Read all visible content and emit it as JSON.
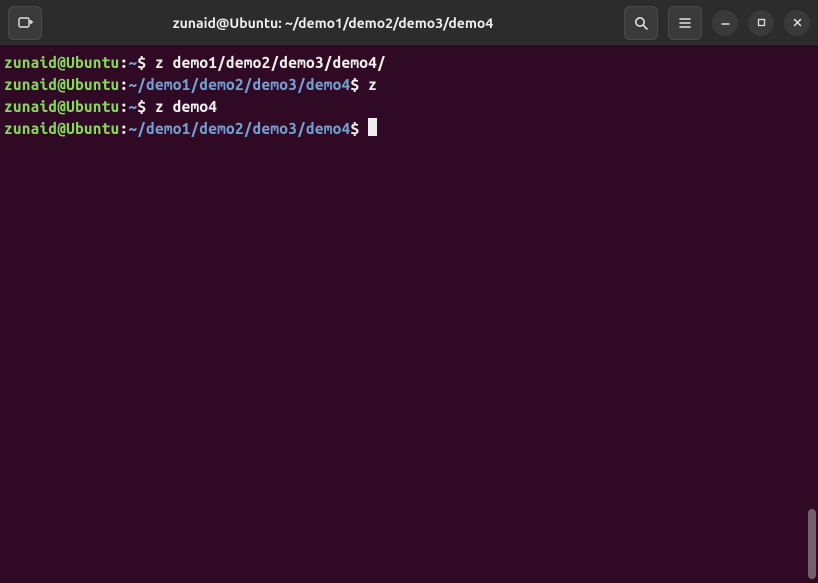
{
  "titlebar": {
    "title": "zunaid@Ubuntu: ~/demo1/demo2/demo3/demo4"
  },
  "terminal": {
    "lines": [
      {
        "user_host": "zunaid@Ubuntu",
        "colon": ":",
        "path": "~",
        "dollar": "$ ",
        "cmd": "z demo1/demo2/demo3/demo4/"
      },
      {
        "user_host": "zunaid@Ubuntu",
        "colon": ":",
        "path": "~/demo1/demo2/demo3/demo4",
        "dollar": "$ ",
        "cmd": "z"
      },
      {
        "user_host": "zunaid@Ubuntu",
        "colon": ":",
        "path": "~",
        "dollar": "$ ",
        "cmd": "z demo4"
      },
      {
        "user_host": "zunaid@Ubuntu",
        "colon": ":",
        "path": "~/demo1/demo2/demo3/demo4",
        "dollar": "$ ",
        "cmd": ""
      }
    ]
  }
}
